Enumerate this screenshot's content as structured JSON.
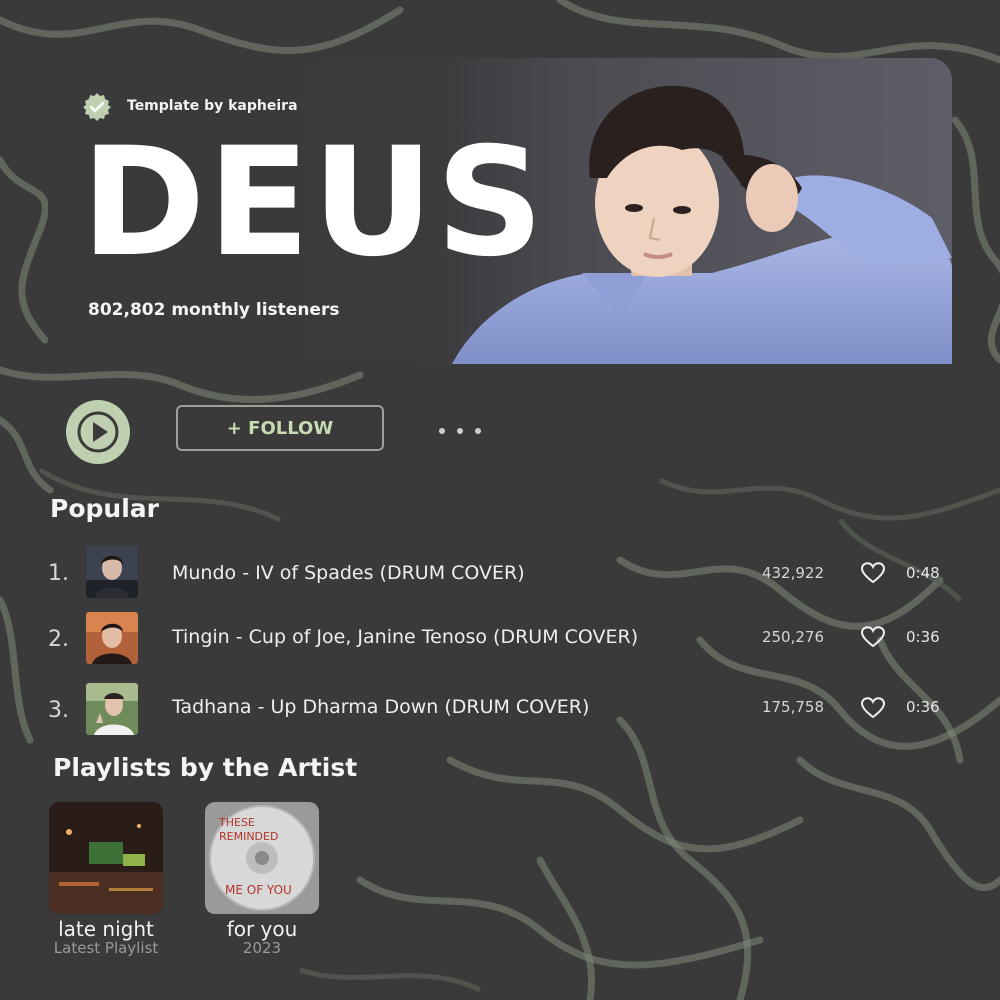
{
  "header": {
    "template_credit": "Template by kapheira",
    "artist_name": "DEUS",
    "monthly_listeners": "802,802 monthly listeners",
    "verified_icon": "check-badge-icon"
  },
  "controls": {
    "play_icon": "play-icon",
    "follow_label": "+ FOLLOW",
    "more_icon": "more-dots-icon"
  },
  "popular": {
    "title": "Popular",
    "tracks": [
      {
        "rank": "1.",
        "title": "Mundo - IV of Spades (DRUM COVER)",
        "plays": "432,922",
        "duration": "0:48"
      },
      {
        "rank": "2.",
        "title": "Tingin - Cup of Joe, Janine Tenoso (DRUM COVER)",
        "plays": "250,276",
        "duration": "0:36"
      },
      {
        "rank": "3.",
        "title": "Tadhana - Up Dharma Down (DRUM COVER)",
        "plays": "175,758",
        "duration": "0:36"
      }
    ]
  },
  "playlists": {
    "title": "Playlists by the Artist",
    "items": [
      {
        "name": "late night",
        "subtitle": "Latest Playlist"
      },
      {
        "name": "for you",
        "subtitle": "2023",
        "cover_text": [
          "THESE",
          "REMINDED",
          "ME OF YOU"
        ]
      }
    ]
  },
  "colors": {
    "background": "#3a3a3a",
    "accent": "#bfd0b0",
    "follow_text": "#c6dbb4"
  }
}
